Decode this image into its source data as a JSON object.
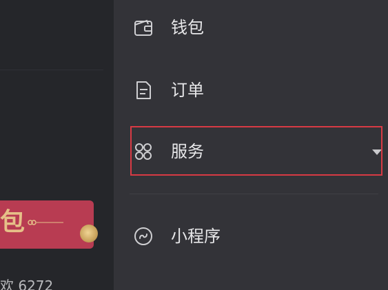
{
  "left": {
    "redpacket_char": "包",
    "bottom_text": "欢 6272"
  },
  "menu": {
    "items": [
      {
        "label": "钱包",
        "icon": "wallet-icon"
      },
      {
        "label": "订单",
        "icon": "order-icon"
      },
      {
        "label": "服务",
        "icon": "service-grid-icon",
        "highlighted": true,
        "expandable": true
      },
      {
        "label": "小程序",
        "icon": "mini-program-icon"
      }
    ]
  },
  "colors": {
    "highlight": "#d93a44",
    "menu_background": "#333338",
    "text": "#e7e7e9"
  }
}
